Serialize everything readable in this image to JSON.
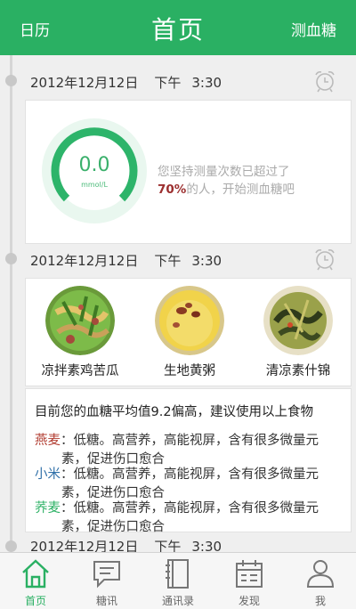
{
  "header": {
    "left_label": "日历",
    "title": "首页",
    "right_label": "测血糖"
  },
  "entries": [
    {
      "date": "2012年12月12日",
      "period": "下午",
      "time": "3:30"
    },
    {
      "date": "2012年12月12日",
      "period": "下午",
      "time": "3:30"
    },
    {
      "date": "2012年12月12日",
      "period": "下午",
      "time": "3:30"
    }
  ],
  "gauge": {
    "value": "0.0",
    "unit": "mmol/L",
    "accent": "#3ab06b"
  },
  "tip": {
    "line1": "您坚持测量次数已超过了",
    "percent": "70%",
    "line2_rest": "的人，开始测血糖吧"
  },
  "foods": [
    {
      "name": "凉拌素鸡苦瓜"
    },
    {
      "name": "生地黄粥"
    },
    {
      "name": "清凉素什锦"
    }
  ],
  "advice": {
    "headline": "目前您的血糖平均值9.2偏高，建议使用以上食物",
    "items": [
      {
        "name": "燕麦",
        "name_color": "#b03a2e",
        "line1": "：低糖。高营养，高能视屏，含有很多微量元",
        "line2": "素，促进伤口愈合"
      },
      {
        "name": "小米",
        "name_color": "#2e6fa8",
        "line1": "：低糖。高营养，高能视屏，含有很多微量元",
        "line2": "素，促进伤口愈合"
      },
      {
        "name": "荞麦",
        "name_color": "#2ab063",
        "line1": "：低糖。高营养，高能视屏，含有很多微量元",
        "line2": "素，促进伤口愈合"
      }
    ]
  },
  "nav": [
    {
      "label": "首页",
      "icon": "home-icon",
      "active": true
    },
    {
      "label": "糖讯",
      "icon": "chat-icon",
      "active": false
    },
    {
      "label": "通讯录",
      "icon": "contacts-icon",
      "active": false
    },
    {
      "label": "发现",
      "icon": "calendar-icon",
      "active": false
    },
    {
      "label": "我",
      "icon": "person-icon",
      "active": false
    }
  ],
  "colors": {
    "brand": "#2ab063"
  }
}
